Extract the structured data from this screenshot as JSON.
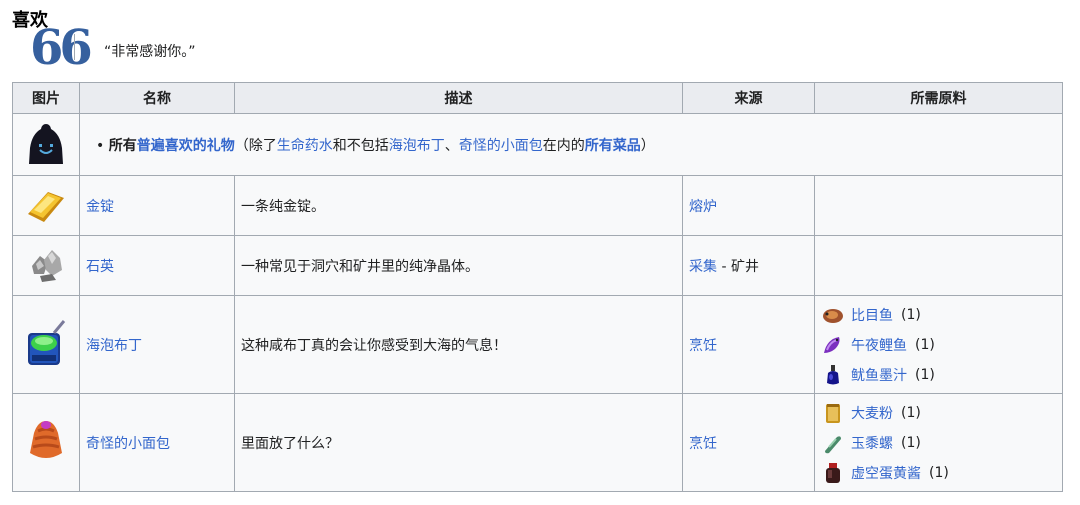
{
  "section": {
    "heading": "喜欢",
    "quote_mark": "66",
    "quote": "“非常感谢你。”"
  },
  "table": {
    "headers": {
      "image": "图片",
      "name": "名称",
      "desc": "描述",
      "source": "来源",
      "ingredients": "所需原料"
    },
    "universal": {
      "prefix": "所有",
      "link1": "普遍喜欢的礼物",
      "mid1": "（除了",
      "link2": "生命药水",
      "mid2": "和不包括",
      "link3": "海泡布丁",
      "mid3": "、",
      "link4": "奇怪的小面包",
      "mid4": "在内的",
      "link5": "所有菜品",
      "suffix": "）"
    },
    "rows": [
      {
        "name": "金锭",
        "desc": "一条纯金锭。",
        "source": "熔炉",
        "source_extra": ""
      },
      {
        "name": "石英",
        "desc": "一种常见于洞穴和矿井里的纯净晶体。",
        "source": "采集",
        "source_extra": " - 矿井"
      },
      {
        "name": "海泡布丁",
        "desc": "这种咸布丁真的会让你感受到大海的气息！",
        "source": "烹饪",
        "source_extra": "",
        "ingredients": [
          {
            "name": "比目鱼",
            "qty": "(1)",
            "icon": "halibut-icon"
          },
          {
            "name": "午夜鲤鱼",
            "qty": "(1)",
            "icon": "midnight-carp-icon"
          },
          {
            "name": "鱿鱼墨汁",
            "qty": "(1)",
            "icon": "squid-ink-icon"
          }
        ]
      },
      {
        "name": "奇怪的小面包",
        "desc": "里面放了什么？",
        "source": "烹饪",
        "source_extra": "",
        "ingredients": [
          {
            "name": "大麦粉",
            "qty": "(1)",
            "icon": "wheat-flour-icon"
          },
          {
            "name": "玉黍螺",
            "qty": "(1)",
            "icon": "periwinkle-icon"
          },
          {
            "name": "虚空蛋黄酱",
            "qty": "(1)",
            "icon": "void-mayonnaise-icon"
          }
        ]
      }
    ]
  },
  "colors": {
    "link": "#3366cc",
    "header_bg": "#eaecf0",
    "cell_bg": "#f8f9fa",
    "border": "#a2a9b1",
    "quote": "#36609e"
  }
}
